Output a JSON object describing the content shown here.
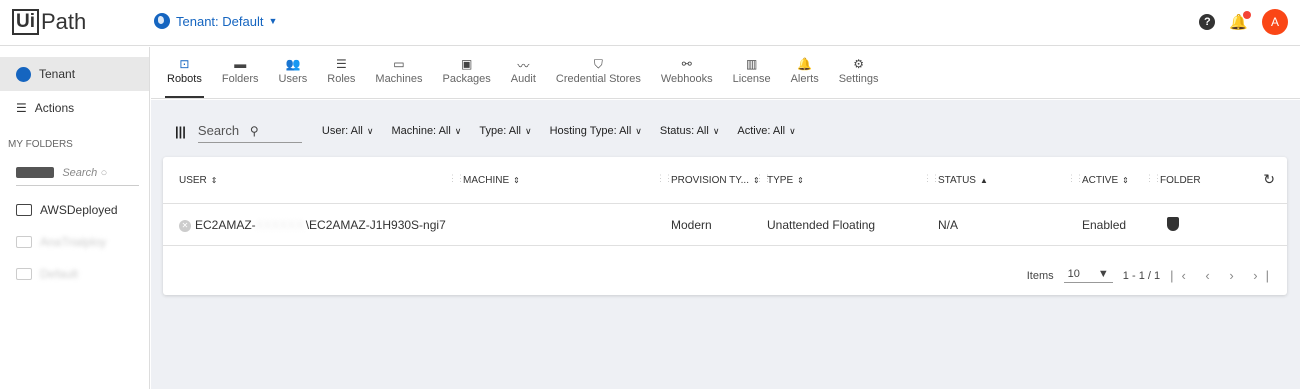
{
  "header": {
    "logo_box": "Ui",
    "logo_rest": "Path",
    "tenant_label": "Tenant: Default",
    "avatar_initial": "A"
  },
  "sidebar": {
    "items": [
      {
        "label": "Tenant",
        "icon": "globe-icon",
        "active": true
      },
      {
        "label": "Actions",
        "icon": "actions-icon",
        "active": false
      }
    ],
    "section_header": "MY FOLDERS",
    "search_placeholder": "Search",
    "folders": [
      "AWSDeployed",
      "AnaTrialploy",
      "Default"
    ]
  },
  "tabs": [
    {
      "label": "Robots",
      "icon": "robot-icon",
      "glyph": "⊡",
      "active": true
    },
    {
      "label": "Folders",
      "icon": "folder-icon",
      "glyph": "▬"
    },
    {
      "label": "Users",
      "icon": "users-icon",
      "glyph": "👥"
    },
    {
      "label": "Roles",
      "icon": "roles-icon",
      "glyph": "☰"
    },
    {
      "label": "Machines",
      "icon": "machine-icon",
      "glyph": "▭"
    },
    {
      "label": "Packages",
      "icon": "package-icon",
      "glyph": "▣"
    },
    {
      "label": "Audit",
      "icon": "audit-icon",
      "glyph": "〰"
    },
    {
      "label": "Credential Stores",
      "icon": "shield-icon",
      "glyph": "⛉"
    },
    {
      "label": "Webhooks",
      "icon": "webhook-icon",
      "glyph": "⚯"
    },
    {
      "label": "License",
      "icon": "license-icon",
      "glyph": "▥"
    },
    {
      "label": "Alerts",
      "icon": "bell-icon",
      "glyph": "🔔"
    },
    {
      "label": "Settings",
      "icon": "gear-icon",
      "glyph": "⚙"
    }
  ],
  "filters": {
    "search_placeholder": "Search",
    "items": [
      "User: All",
      "Machine: All",
      "Type: All",
      "Hosting Type: All",
      "Status: All",
      "Active: All"
    ]
  },
  "table": {
    "columns": [
      "USER",
      "MACHINE",
      "PROVISION TY...",
      "TYPE",
      "STATUS",
      "ACTIVE",
      "FOLDER"
    ],
    "rows": [
      {
        "user_prefix": "EC2AMAZ-",
        "user_redacted": "XXXXXX",
        "user_suffix": "\\EC2AMAZ-J1H930S-ngi7",
        "machine": "",
        "provision": "Modern",
        "type": "Unattended Floating",
        "status": "N/A",
        "active": "Enabled"
      }
    ],
    "footer": {
      "items_label": "Items",
      "page_size": "10",
      "range": "1 - 1 / 1"
    }
  },
  "colors": {
    "accent": "#1565c0",
    "avatar_bg": "#fa4616",
    "content_bg": "#eef0f4"
  }
}
